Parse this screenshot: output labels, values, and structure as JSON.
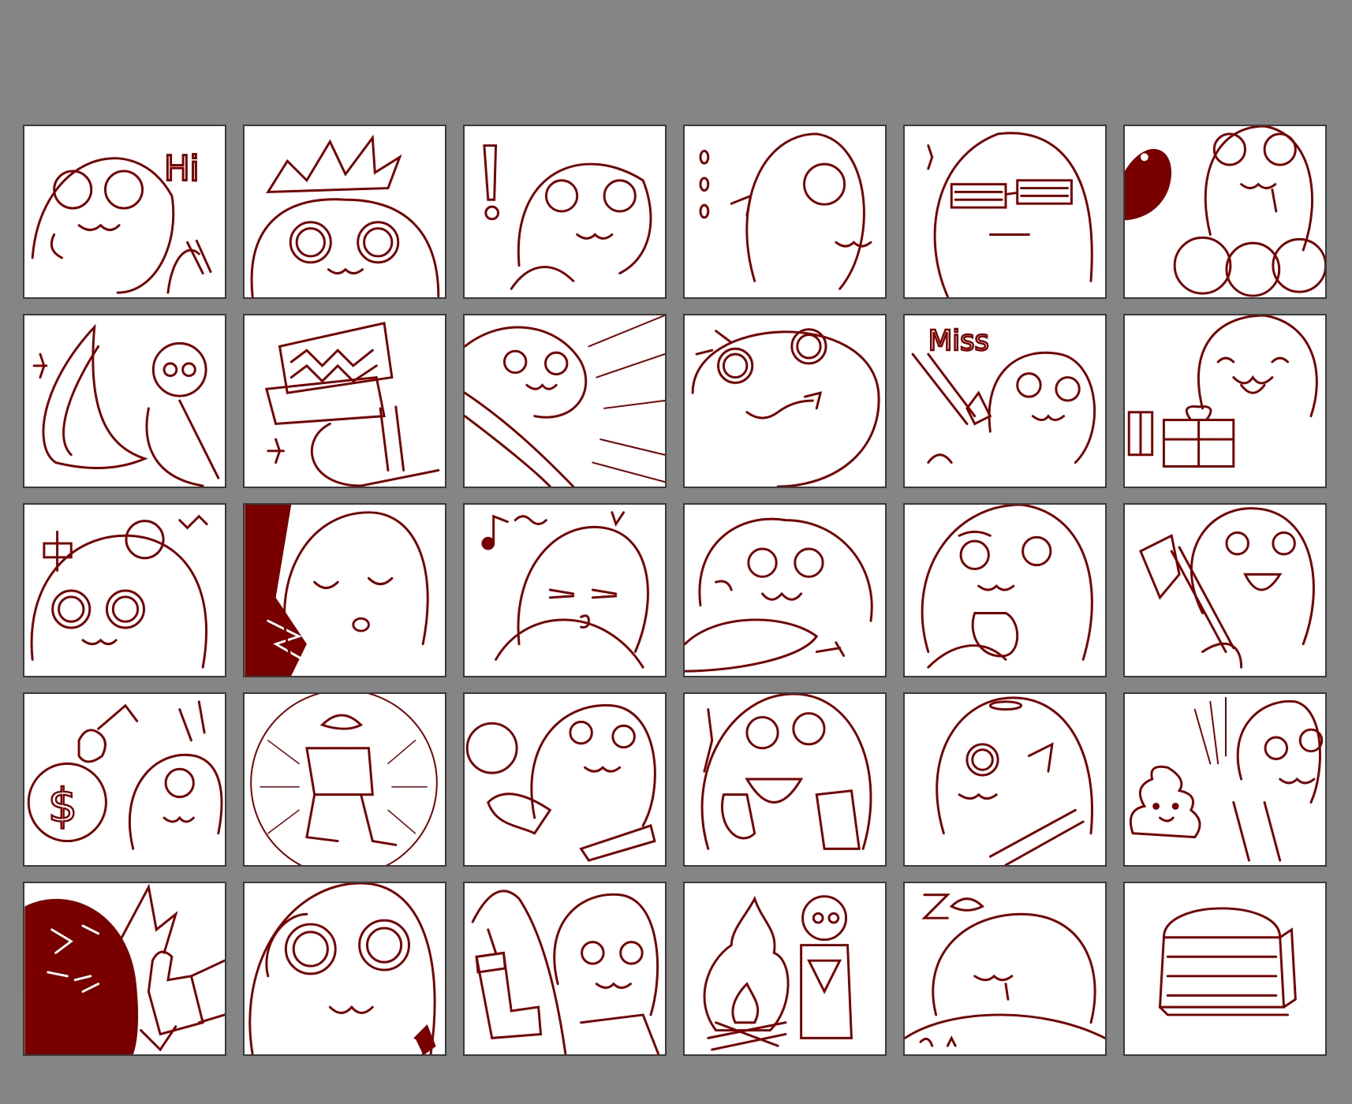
{
  "sheet": {
    "background": "#858585",
    "ink_color": "#7a0000",
    "rows": 5,
    "columns": 6
  },
  "emotes": [
    {
      "icon": "hi-wave-icon",
      "text": "Hi"
    },
    {
      "icon": "crown-icon",
      "text": ""
    },
    {
      "icon": "exclamation-icon",
      "text": ""
    },
    {
      "icon": "ellipsis-icon",
      "text": ""
    },
    {
      "icon": "glasses-icon",
      "text": ""
    },
    {
      "icon": "drool-icon",
      "text": ""
    },
    {
      "icon": "boomerang-icon",
      "text": ""
    },
    {
      "icon": "trap-icon",
      "text": ""
    },
    {
      "icon": "speed-lines-icon",
      "text": ""
    },
    {
      "icon": "smug-icon",
      "text": ""
    },
    {
      "icon": "miss-icon",
      "text": "Miss"
    },
    {
      "icon": "gift-icon",
      "text": ""
    },
    {
      "icon": "bump-icon",
      "text": ""
    },
    {
      "icon": "whistle-icon",
      "text": ""
    },
    {
      "icon": "music-icon",
      "text": ""
    },
    {
      "icon": "eating-icon",
      "text": ""
    },
    {
      "icon": "thinking-icon",
      "text": ""
    },
    {
      "icon": "axe-icon",
      "text": ""
    },
    {
      "icon": "money-bag-icon",
      "text": ""
    },
    {
      "icon": "rolling-icon",
      "text": ""
    },
    {
      "icon": "bubble-icon",
      "text": ""
    },
    {
      "icon": "cheer-icon",
      "text": ""
    },
    {
      "icon": "halo-icon",
      "text": ""
    },
    {
      "icon": "poop-icon",
      "text": ""
    },
    {
      "icon": "thumbs-up-icon",
      "text": ""
    },
    {
      "icon": "surprised-icon",
      "text": ""
    },
    {
      "icon": "stocking-icon",
      "text": ""
    },
    {
      "icon": "campfire-icon",
      "text": ""
    },
    {
      "icon": "sleeping-icon",
      "text": ""
    },
    {
      "icon": "treasure-chest-icon",
      "text": ""
    }
  ]
}
